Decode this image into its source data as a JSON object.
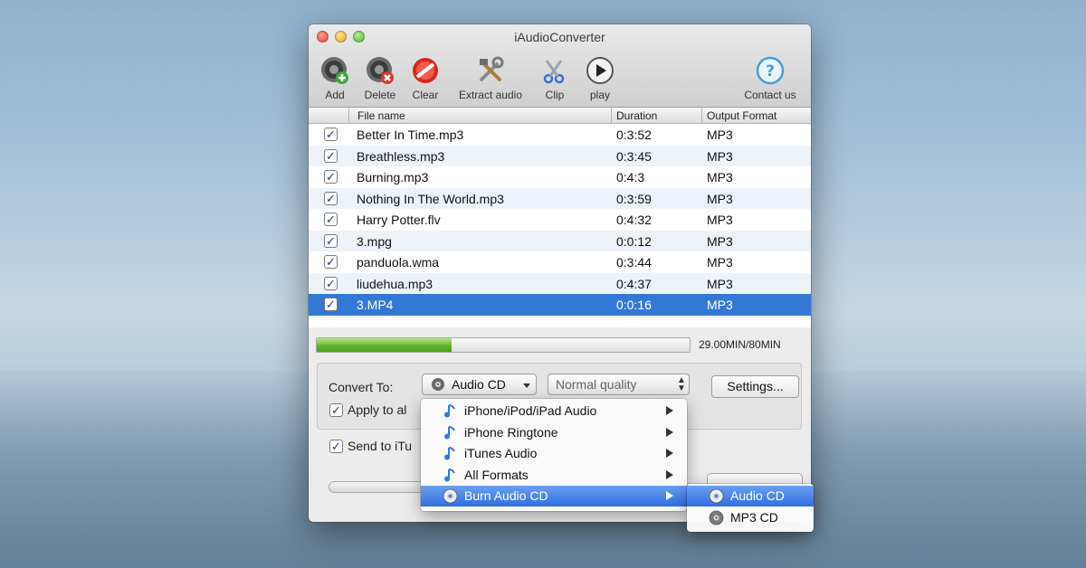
{
  "window": {
    "title": "iAudioConverter"
  },
  "toolbar": {
    "add": {
      "label": "Add",
      "icon": "speaker-add-icon"
    },
    "delete": {
      "label": "Delete",
      "icon": "speaker-delete-icon"
    },
    "clear": {
      "label": "Clear",
      "icon": "clear-icon"
    },
    "extract": {
      "label": "Extract audio",
      "icon": "tools-icon"
    },
    "clip": {
      "label": "Clip",
      "icon": "scissors-icon"
    },
    "play": {
      "label": "play",
      "icon": "play-icon"
    },
    "contact": {
      "label": "Contact us",
      "icon": "help-icon"
    }
  },
  "table": {
    "columns": [
      "File name",
      "Duration",
      "Output Format"
    ],
    "rows": [
      {
        "checked": true,
        "name": "Better In Time.mp3",
        "duration": "0:3:52",
        "format": "MP3"
      },
      {
        "checked": true,
        "name": "Breathless.mp3",
        "duration": "0:3:45",
        "format": "MP3"
      },
      {
        "checked": true,
        "name": "Burning.mp3",
        "duration": "0:4:3",
        "format": "MP3"
      },
      {
        "checked": true,
        "name": "Nothing In The World.mp3",
        "duration": "0:3:59",
        "format": "MP3"
      },
      {
        "checked": true,
        "name": "Harry Potter.flv",
        "duration": "0:4:32",
        "format": "MP3"
      },
      {
        "checked": true,
        "name": "3.mpg",
        "duration": "0:0:12",
        "format": "MP3"
      },
      {
        "checked": true,
        "name": "panduola.wma",
        "duration": "0:3:44",
        "format": "MP3"
      },
      {
        "checked": true,
        "name": "liudehua.mp3",
        "duration": "0:4:37",
        "format": "MP3"
      },
      {
        "checked": true,
        "name": "3.MP4",
        "duration": "0:0:16",
        "format": "MP3",
        "selected": true
      }
    ]
  },
  "capacity": {
    "text": "29.00MIN/80MIN",
    "fraction": 0.3625
  },
  "convert": {
    "label": "Convert To:",
    "format_value": "Audio CD",
    "quality_value": "Normal quality",
    "settings_label": "Settings...",
    "apply_all_label": "Apply to al",
    "send_itunes_label": "Send to iTu"
  },
  "menu": {
    "items": [
      {
        "label": "iPhone/iPod/iPad Audio",
        "icon": "music-note-icon",
        "submenu": true
      },
      {
        "label": "iPhone Ringtone",
        "icon": "music-note-icon",
        "submenu": true
      },
      {
        "label": "iTunes Audio",
        "icon": "music-note-icon",
        "submenu": true
      },
      {
        "label": "All Formats",
        "icon": "music-note-icon",
        "submenu": true
      },
      {
        "label": "Burn Audio CD",
        "icon": "cd-icon",
        "submenu": true,
        "highlighted": true
      }
    ],
    "submenu": [
      {
        "label": "Audio CD",
        "icon": "cd-icon",
        "highlighted": true
      },
      {
        "label": "MP3 CD",
        "icon": "cd-icon"
      }
    ]
  },
  "colors": {
    "selection": "#3478d6",
    "progress": "#62b52b",
    "menu_highlight": "#2f6ee0"
  }
}
